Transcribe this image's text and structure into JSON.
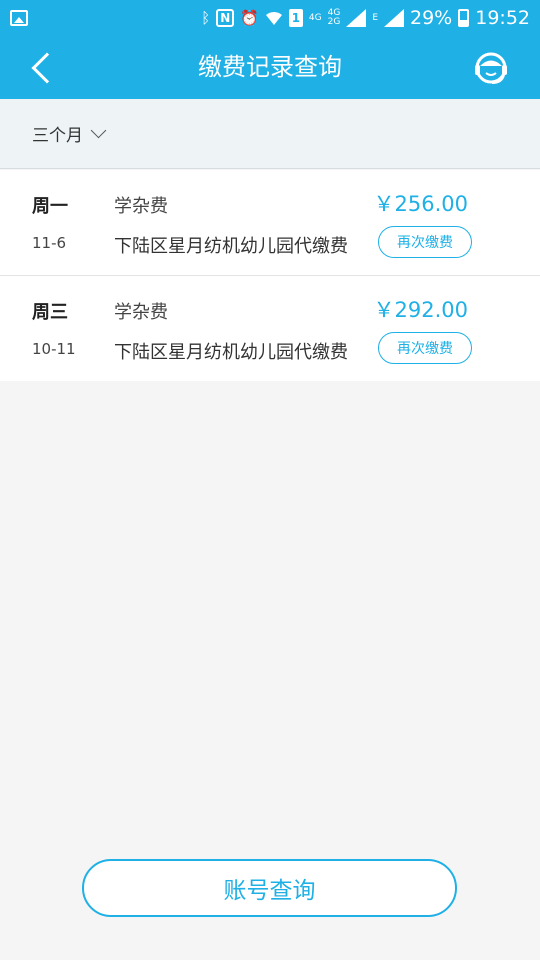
{
  "status_bar": {
    "battery_percent": "29%",
    "time": "19:52",
    "network_4g": "4G",
    "network_4g_2g_top": "4G",
    "network_4g_2g_bottom": "2G",
    "network_e": "E",
    "sim_slot": "1",
    "nfc": "N"
  },
  "header": {
    "title": "缴费记录查询"
  },
  "filter": {
    "label": "三个月"
  },
  "records": [
    {
      "day": "周一",
      "date": "11-6",
      "type": "学杂费",
      "school": "下陆区星月纺机幼儿园代缴费",
      "amount": "￥256.00",
      "repay_label": "再次缴费"
    },
    {
      "day": "周三",
      "date": "10-11",
      "type": "学杂费",
      "school": "下陆区星月纺机幼儿园代缴费",
      "amount": "￥292.00",
      "repay_label": "再次缴费"
    }
  ],
  "footer": {
    "account_button_label": "账号查询"
  },
  "colors": {
    "accent": "#1fb0e6",
    "background": "#f5f5f5",
    "filter_bg": "#eef4f6"
  }
}
